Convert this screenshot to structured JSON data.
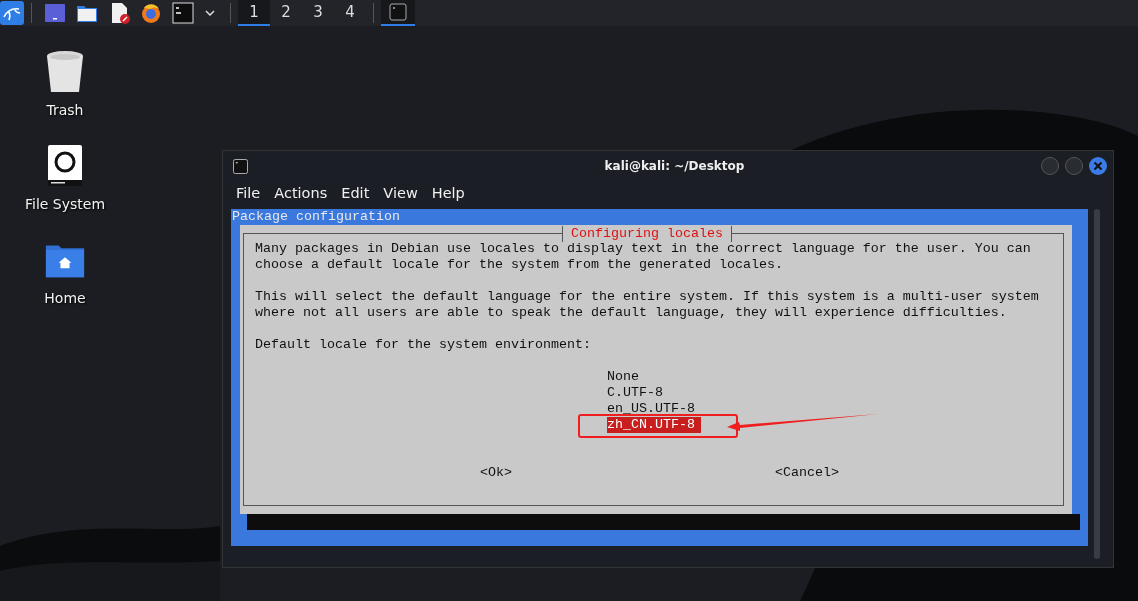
{
  "taskbar": {
    "workspaces": [
      {
        "label": "1",
        "selected": true
      },
      {
        "label": "2",
        "selected": false
      },
      {
        "label": "3",
        "selected": false
      },
      {
        "label": "4",
        "selected": false
      }
    ],
    "tasks": [
      {
        "kind": "terminal",
        "selected": true
      }
    ]
  },
  "desktop_icons": [
    {
      "label": "Trash",
      "kind": "trash"
    },
    {
      "label": "File System",
      "kind": "drive"
    },
    {
      "label": "Home",
      "kind": "home"
    }
  ],
  "window": {
    "title": "kali@kali: ~/Desktop",
    "menu": [
      "File",
      "Actions",
      "Edit",
      "View",
      "Help"
    ]
  },
  "terminal": {
    "header": "Package configuration",
    "dialog": {
      "title": "Configuring locales",
      "paragraphs": [
        "Many packages in Debian use locales to display text in the correct language for the user. You can choose a default locale for the system from the generated locales.",
        "This will select the default language for the entire system. If this system is a multi-user system where not all users are able to speak the default language, they will experience difficulties.",
        "Default locale for the system environment:"
      ],
      "options": [
        {
          "label": "None",
          "selected": false
        },
        {
          "label": "C.UTF-8",
          "selected": false
        },
        {
          "label": "en_US.UTF-8",
          "selected": false
        },
        {
          "label": "zh_CN.UTF-8",
          "selected": true
        }
      ],
      "buttons": [
        {
          "label": "<Ok>"
        },
        {
          "label": "<Cancel>"
        }
      ]
    }
  }
}
